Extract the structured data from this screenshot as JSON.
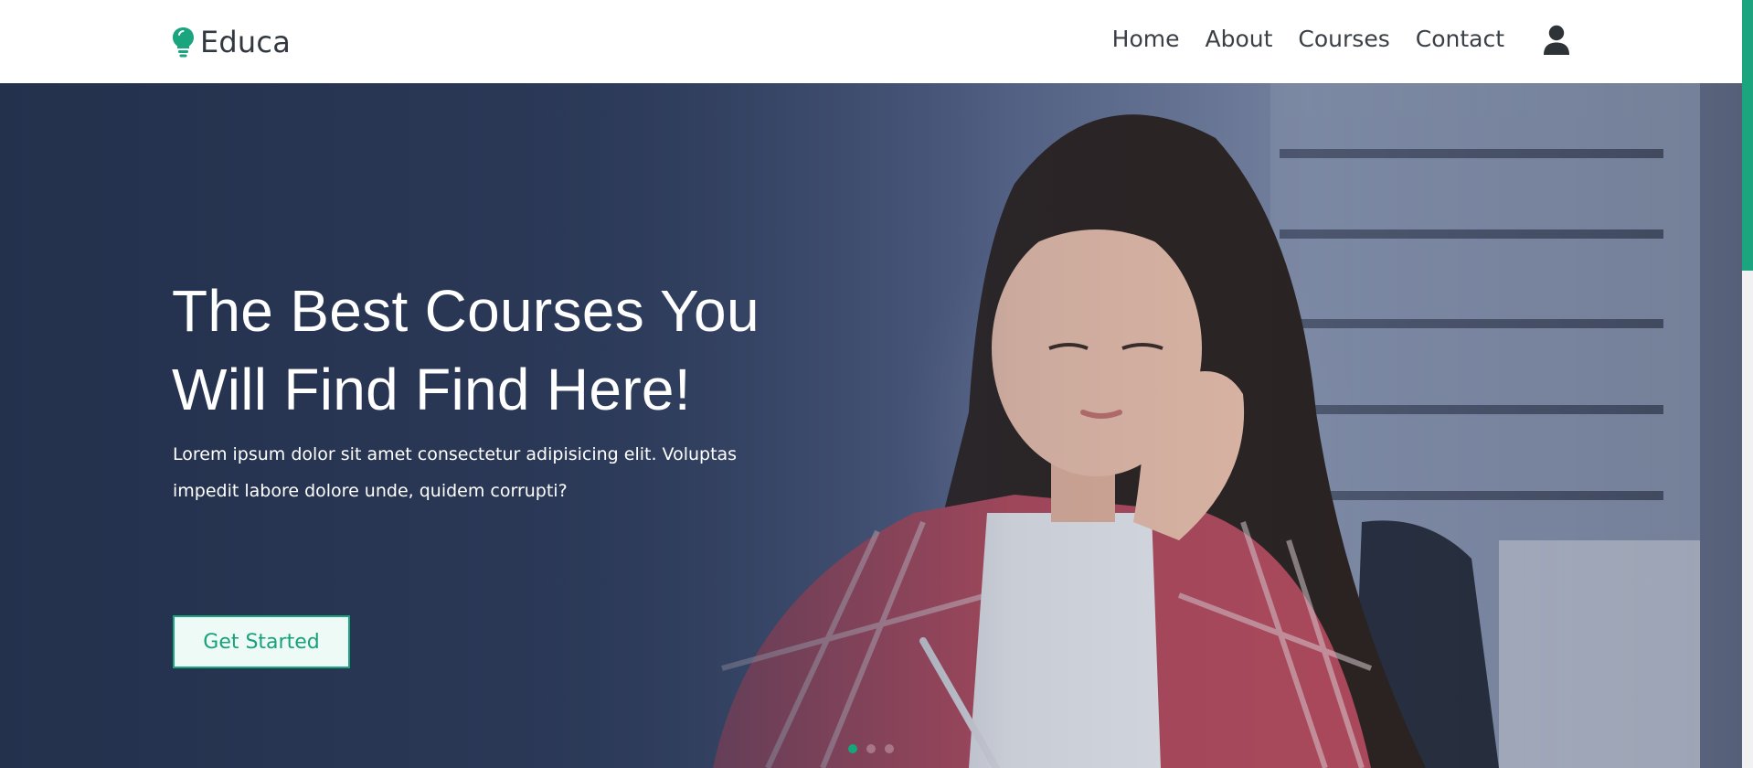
{
  "header": {
    "brand": "Educa",
    "nav": [
      "Home",
      "About",
      "Courses",
      "Contact"
    ]
  },
  "hero": {
    "title_line1": "The Best Courses You",
    "title_line2": "Will Find Find Here!",
    "description_line1": "Lorem ipsum dolor sit amet consectetur adipisicing elit. Voluptas",
    "description_line2": "impedit labore dolore unde, quidem corrupti?",
    "cta_label": "Get Started"
  },
  "carousel": {
    "slide_count": 3,
    "active_index": 0
  },
  "colors": {
    "accent": "#1aa57f",
    "text_dark": "#3b4046",
    "hero_overlay": "#2b3855"
  },
  "icons": {
    "logo": "lightbulb-icon",
    "account": "user-icon"
  }
}
